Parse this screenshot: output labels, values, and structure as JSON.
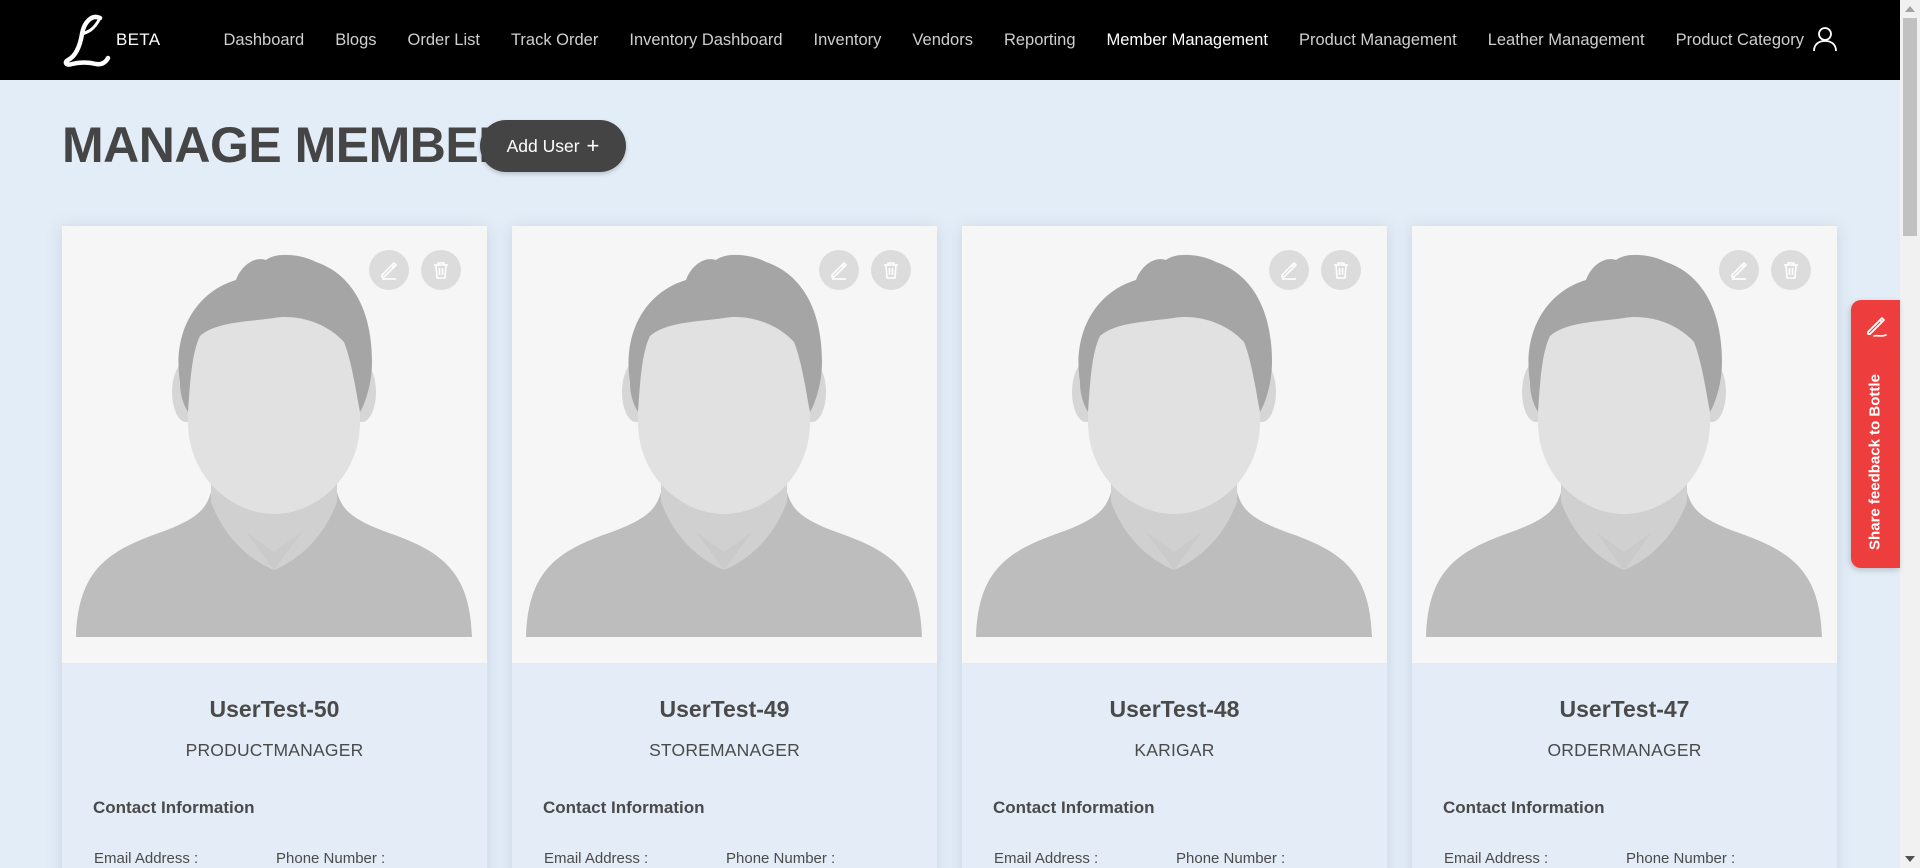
{
  "brand": {
    "text": "BETA"
  },
  "nav": {
    "items": [
      {
        "label": "Dashboard",
        "active": false
      },
      {
        "label": "Blogs",
        "active": false
      },
      {
        "label": "Order List",
        "active": false
      },
      {
        "label": "Track Order",
        "active": false
      },
      {
        "label": "Inventory Dashboard",
        "active": false
      },
      {
        "label": "Inventory",
        "active": false
      },
      {
        "label": "Vendors",
        "active": false
      },
      {
        "label": "Reporting",
        "active": false
      },
      {
        "label": "Member Management",
        "active": true
      },
      {
        "label": "Product Management",
        "active": false
      },
      {
        "label": "Leather Management",
        "active": false
      },
      {
        "label": "Product Category",
        "active": false
      }
    ],
    "user_icon": "user-icon"
  },
  "page": {
    "title": "MANAGE MEMBER",
    "add_user_label": "Add User",
    "add_user_icon": "+"
  },
  "members": [
    {
      "name": "UserTest-50",
      "role": "PRODUCTMANAGER",
      "contact_heading": "Contact Information",
      "email_label": "Email Address :",
      "phone_label": "Phone Number :"
    },
    {
      "name": "UserTest-49",
      "role": "STOREMANAGER",
      "contact_heading": "Contact Information",
      "email_label": "Email Address :",
      "phone_label": "Phone Number :"
    },
    {
      "name": "UserTest-48",
      "role": "KARIGAR",
      "contact_heading": "Contact Information",
      "email_label": "Email Address :",
      "phone_label": "Phone Number :"
    },
    {
      "name": "UserTest-47",
      "role": "ORDERMANAGER",
      "contact_heading": "Contact Information",
      "email_label": "Email Address :",
      "phone_label": "Phone Number :"
    }
  ],
  "feedback": {
    "label": "Share feedback to Bottle",
    "icon": "pencil-icon"
  },
  "colors": {
    "nav_bg": "#000000",
    "page_bg": "#e3edf7",
    "add_button": "#444444",
    "feedback": "#ee3d3d"
  }
}
